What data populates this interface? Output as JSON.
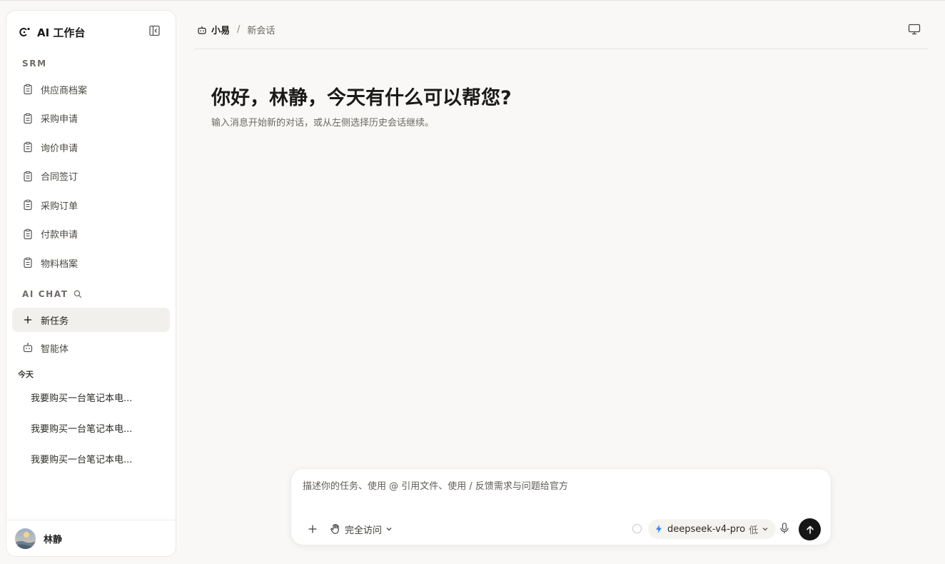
{
  "brand": {
    "title": "AI 工作台"
  },
  "sidebar": {
    "srm_label": "SRM",
    "srm_items": [
      {
        "label": "供应商档案",
        "icon": "clipboard-icon"
      },
      {
        "label": "采购申请",
        "icon": "clipboard-icon"
      },
      {
        "label": "询价申请",
        "icon": "clipboard-icon"
      },
      {
        "label": "合同签订",
        "icon": "clipboard-icon"
      },
      {
        "label": "采购订单",
        "icon": "clipboard-icon"
      },
      {
        "label": "付款申请",
        "icon": "clipboard-icon"
      },
      {
        "label": "物料档案",
        "icon": "clipboard-icon"
      }
    ],
    "chat_label": "AI CHAT",
    "new_task": "新任务",
    "agents": "智能体",
    "today_label": "今天",
    "history": [
      "我要购买一台笔记本电...",
      "我要购买一台笔记本电...",
      "我要购买一台笔记本电..."
    ],
    "user_name": "林静"
  },
  "header": {
    "agent_name": "小易",
    "separator": "/",
    "current": "新会话"
  },
  "welcome": {
    "greeting": "你好，林静，今天有什么可以帮您?",
    "subtext": "输入消息开始新的对话，或从左侧选择历史会话继续。"
  },
  "composer": {
    "placeholder": "描述你的任务、使用 @ 引用文件、使用 / 反馈需求与问题给官方",
    "access_label": "完全访问",
    "model": "deepseek-v4-pro",
    "effort": "低"
  },
  "colors": {
    "background": "#f9f8f6",
    "sidebar": "#ffffff",
    "send_button": "#161616",
    "model_bolt": "#3b82f6"
  }
}
